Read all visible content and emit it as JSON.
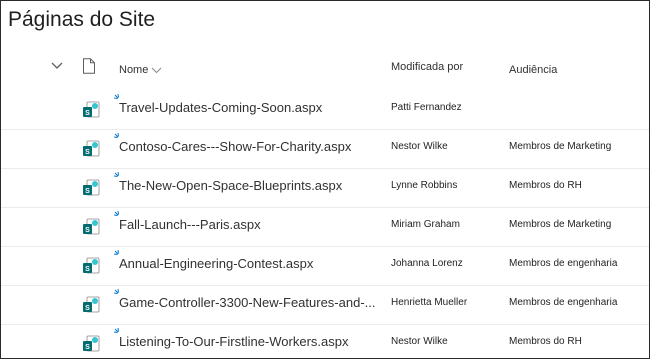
{
  "page": {
    "title": "Páginas do Site"
  },
  "columns": {
    "name": "Nome",
    "modified_by": "Modificada por",
    "audience": "Audiência"
  },
  "icons": {
    "collapse": "chevron-down-icon",
    "file_type": "document-icon",
    "page": "sharepoint-page-icon",
    "new_item": "new-item-sparkle-icon",
    "sort": "chevron-down-icon"
  },
  "colors": {
    "accent": "#0078d4",
    "sharepoint_teal": "#036c70",
    "sharepoint_light": "#37c6d0"
  },
  "rows": [
    {
      "name": "Travel-Updates-Coming-Soon.aspx",
      "modified_by": "Patti Fernandez",
      "audience": ""
    },
    {
      "name": "Contoso-Cares---Show-For-Charity.aspx",
      "modified_by": "Nestor Wilke",
      "audience": "Membros de Marketing"
    },
    {
      "name": "The-New-Open-Space-Blueprints.aspx",
      "modified_by": "Lynne Robbins",
      "audience": "Membros do RH"
    },
    {
      "name": "Fall-Launch---Paris.aspx",
      "modified_by": "Miriam Graham",
      "audience": "Membros de Marketing"
    },
    {
      "name": "Annual-Engineering-Contest.aspx",
      "modified_by": "Johanna Lorenz",
      "audience": "Membros de engenharia"
    },
    {
      "name": "Game-Controller-3300-New-Features-and-...",
      "modified_by": "Henrietta Mueller",
      "audience": "Membros de engenharia"
    },
    {
      "name": "Listening-To-Our-Firstline-Workers.aspx",
      "modified_by": "Nestor Wilke",
      "audience": "Membros do RH"
    }
  ]
}
